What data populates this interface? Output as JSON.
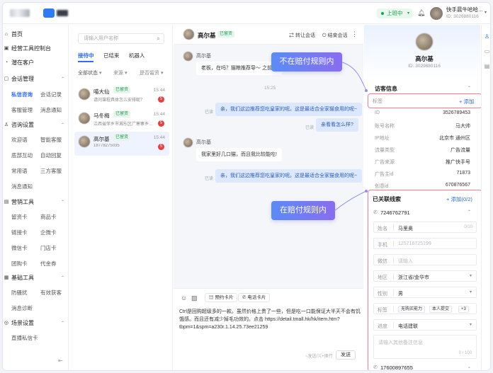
{
  "topbar": {
    "status": "上班中",
    "user_name": "快手晨牛哈哈...",
    "user_id": "ID: 3026880116"
  },
  "sidebar": {
    "groups": [
      {
        "label": "首页",
        "icon": "home-icon"
      },
      {
        "label": "经营工具控制台",
        "icon": "dashboard-icon"
      },
      {
        "label": "潜在客户",
        "icon": "user-icon"
      },
      {
        "label": "会话管理",
        "icon": "chat-icon",
        "items": [
          "私信咨询",
          "会话记录",
          "客服管理",
          "消息通知"
        ]
      },
      {
        "label": "咨询设置",
        "icon": "person-icon",
        "items": [
          "欢迎语",
          "智能客服",
          "底部互动",
          "自动回复",
          "常用语",
          "三方客服",
          "消息通知"
        ]
      },
      {
        "label": "营销工具",
        "icon": "tool-icon",
        "items": [
          "留资卡",
          "商品卡",
          "链接卡",
          "企微卡",
          "微信卡",
          "门店卡",
          "团购卡",
          "代金券"
        ]
      },
      {
        "label": "基础工具",
        "icon": "grid-icon",
        "items": [
          "防骚扰",
          "有效获客",
          "消息诊断"
        ]
      },
      {
        "label": "场景设置",
        "icon": "scene-icon",
        "items": [
          "直播私信卡"
        ]
      }
    ],
    "collapse_icon": "collapse-icon"
  },
  "convlist": {
    "search_placeholder": "请输入用户名称",
    "tabs": [
      "接待中",
      "已结束",
      "机器人"
    ],
    "filters": [
      {
        "label": "全部状态"
      },
      {
        "label": "来源"
      },
      {
        "label": "是否留资"
      }
    ],
    "items": [
      {
        "name": "喵大仙",
        "badge": "已留资",
        "preview": "请问课程具体怎么安排呢？",
        "time": "15:44",
        "unread": "5"
      },
      {
        "name": "马冬梅",
        "badge": "已留资",
        "preview": "江西省萍乡市湘东区广寒寨乡8...",
        "time": "15:44",
        "unread": "5"
      },
      {
        "name": "高尔基",
        "badge": "已留资",
        "preview": "18778275035",
        "time": "15:44",
        "unread": "5"
      }
    ]
  },
  "chat": {
    "contact": "高尔基",
    "badge": "已留资",
    "transfer": "转让会话",
    "end": "结束会话",
    "messages": {
      "m1_name": "高尔基",
      "m1_text": "老板，在吗？猫粮推荐导～ 之前的",
      "time": "15:25",
      "o1_read": "已读",
      "o1_text": "亲，我们这边推荐您吃皇家的呢。这是最适合全家猫食用的呢~",
      "o2_read": "已读",
      "o2_text": "亲看看怎么样?",
      "m2_name": "高尔基",
      "m2_text": "我家里好几口猫，而且我比较能吃!",
      "o3_read": "已读",
      "o3_text": "亲，我们这边推荐您吃皇家的呢。这是最适合全家猫食用的呢~"
    },
    "callout_top": "不在赔付规则内",
    "callout_bottom": "在赔付规则内",
    "composer": {
      "btn_card": "预约卡片",
      "btn_phone": "电话卡片",
      "text": "Ctrl是回购超级多的一款。虽然价格上贵了一些，但是吃一口能保证大半天不会有饥饿感。而且还有减少掉毛功效的。点击 https://detail.tmall.hk/hk/item.htm?tbpm=1&spm=a230r.1.14.25.73ee21259",
      "hint": "~发送/⌘+换行",
      "send": "发送"
    }
  },
  "right": {
    "name": "高尔基",
    "id": "ID: 3029880116",
    "visitor_title": "访客信息",
    "tag_label": "标签",
    "tag_add": "+ 添加",
    "info": [
      {
        "k": "ID",
        "v": "3526789453"
      },
      {
        "k": "账号名称",
        "v": "马大帅"
      },
      {
        "k": "IP地址",
        "v": "北京市 通州区"
      },
      {
        "k": "流量类型",
        "v": "广告流量"
      },
      {
        "k": "广告来源",
        "v": "推广快手号"
      },
      {
        "k": "广告主id",
        "v": "71873"
      },
      {
        "k": "创意id",
        "v": "670876567"
      }
    ],
    "leads_title": "已关联线索",
    "leads_add": "+ 添加(0/2)",
    "phone1": "7246762791",
    "form": {
      "name_label": "姓名",
      "name_value": "马里奥",
      "name_count": "0/10",
      "phone_label": "手机",
      "phone_value": "125716725199",
      "wechat_label": "微信",
      "wechat_placeholder": "请输入",
      "region_label": "地区",
      "region_value": "浙江省/金华市",
      "gender_label": "性别",
      "gender_value": "男",
      "tag_label": "标签",
      "tag_chips": [
        "无购买能力",
        "本人提交",
        "+3"
      ],
      "progress_label": "进度",
      "progress_value": "电话建联",
      "remark_placeholder": "请输入其他备注信息",
      "remark_count": "0 / 100"
    },
    "phone2": "17600897655"
  },
  "rail": [
    "person-icon",
    "chat-icon",
    "doc-icon"
  ]
}
